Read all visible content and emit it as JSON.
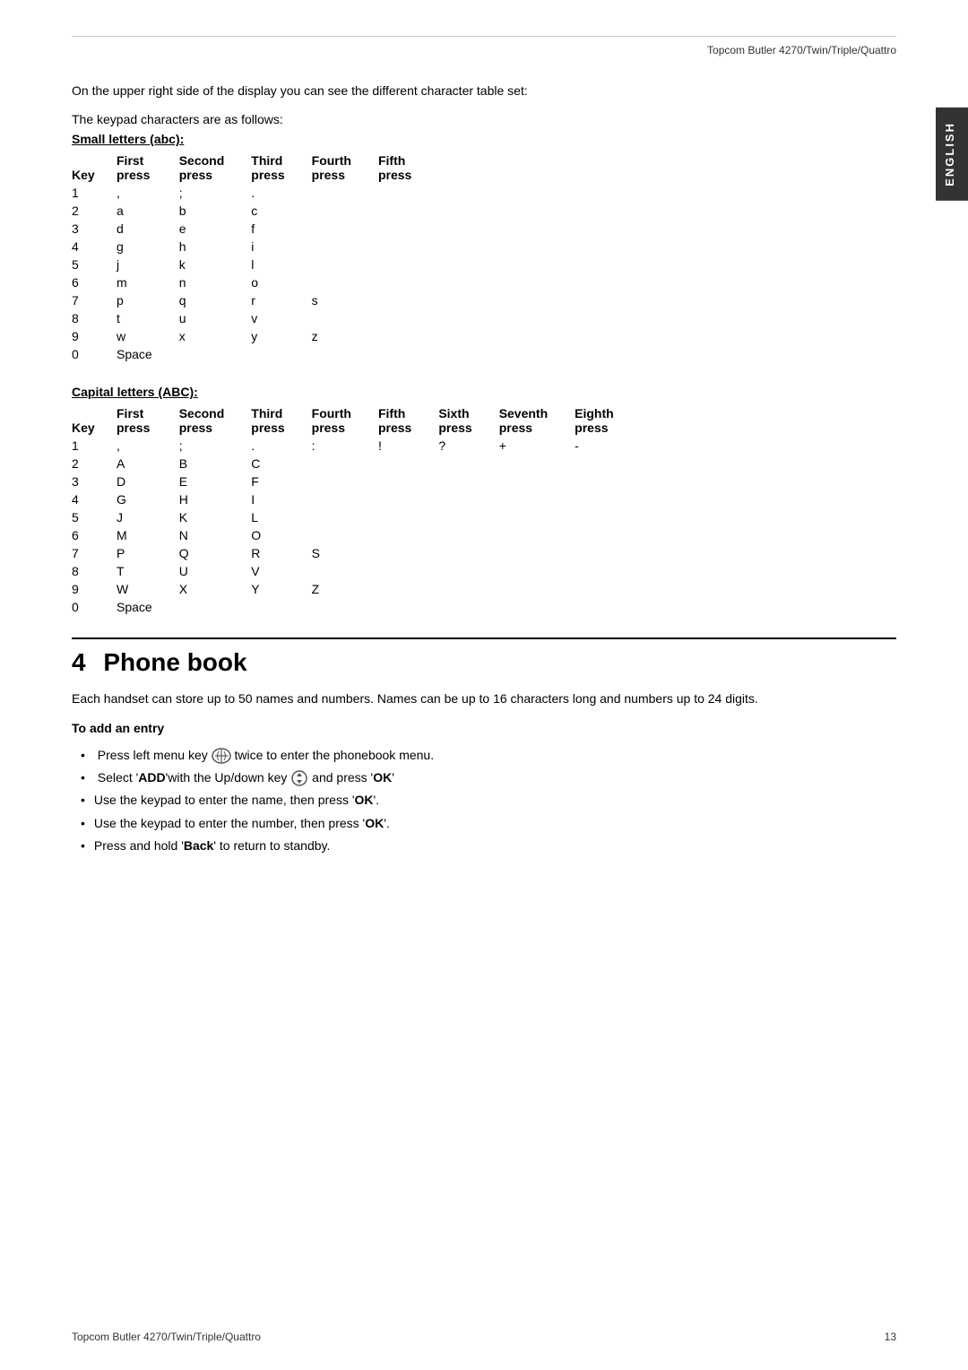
{
  "header": {
    "brand": "Topcom Butler 4270/Twin/Triple/Quattro"
  },
  "side_tab": {
    "label": "ENGLISH"
  },
  "intro": {
    "line1": "On the upper right side of the display you can see the different character table set:",
    "line2": "The keypad characters are as follows:"
  },
  "small_letters": {
    "title": "Small letters (abc):",
    "columns": [
      "Key",
      "First\npress",
      "Second\npress",
      "Third\npress",
      "Fourth\npress",
      "Fifth\npress"
    ],
    "rows": [
      [
        "1",
        ",",
        ";",
        ".",
        "",
        ""
      ],
      [
        "2",
        "a",
        "b",
        "c",
        "",
        ""
      ],
      [
        "3",
        "d",
        "e",
        "f",
        "",
        ""
      ],
      [
        "4",
        "g",
        "h",
        "i",
        "",
        ""
      ],
      [
        "5",
        "j",
        "k",
        "l",
        "",
        ""
      ],
      [
        "6",
        "m",
        "n",
        "o",
        "",
        ""
      ],
      [
        "7",
        "p",
        "q",
        "r",
        "s",
        ""
      ],
      [
        "8",
        "t",
        "u",
        "v",
        "",
        ""
      ],
      [
        "9",
        "w",
        "x",
        "y",
        "z",
        ""
      ],
      [
        "0",
        "Space",
        "",
        "",
        "",
        ""
      ]
    ]
  },
  "capital_letters": {
    "title": "Capital letters (ABC):",
    "columns": [
      "Key",
      "First\npress",
      "Second\npress",
      "Third\npress",
      "Fourth\npress",
      "Fifth\npress",
      "Sixth\npress",
      "Seventh\npress",
      "Eighth\npress"
    ],
    "rows": [
      [
        "1",
        ",",
        ";",
        ".",
        ":",
        "!",
        "?",
        "+",
        "-"
      ],
      [
        "2",
        "A",
        "B",
        "C",
        "",
        "",
        "",
        "",
        ""
      ],
      [
        "3",
        "D",
        "E",
        "F",
        "",
        "",
        "",
        "",
        ""
      ],
      [
        "4",
        "G",
        "H",
        "I",
        "",
        "",
        "",
        "",
        ""
      ],
      [
        "5",
        "J",
        "K",
        "L",
        "",
        "",
        "",
        "",
        ""
      ],
      [
        "6",
        "M",
        "N",
        "O",
        "",
        "",
        "",
        "",
        ""
      ],
      [
        "7",
        "P",
        "Q",
        "R",
        "S",
        "",
        "",
        "",
        ""
      ],
      [
        "8",
        "T",
        "U",
        "V",
        "",
        "",
        "",
        "",
        ""
      ],
      [
        "9",
        "W",
        "X",
        "Y",
        "Z",
        "",
        "",
        "",
        ""
      ],
      [
        "0",
        "Space",
        "",
        "",
        "",
        "",
        "",
        "",
        ""
      ]
    ]
  },
  "phone_book": {
    "chapter_number": "4",
    "chapter_title": "Phone book",
    "description": "Each handset can store up to 50 names and numbers. Names can be up to 16 characters long and numbers up to 24 digits.",
    "add_entry": {
      "heading": "To add an entry",
      "bullets": [
        "Press left menu key  twice to enter the phonebook menu.",
        "Select 'ADD' with the Up/down key  and press 'OK'",
        "Use the keypad to enter the name, then press 'OK'.",
        "Use the keypad to enter the number, then press 'OK'.",
        "Press and hold 'Back' to return to standby."
      ]
    }
  },
  "footer": {
    "brand": "Topcom Butler 4270/Twin/Triple/Quattro",
    "page_number": "13"
  }
}
